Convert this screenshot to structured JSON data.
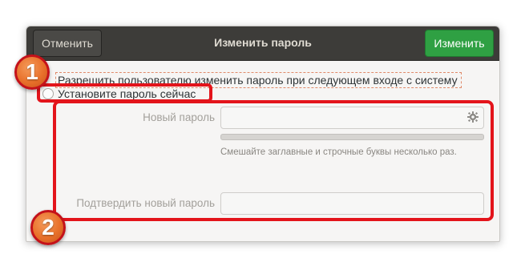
{
  "dialog": {
    "title": "Изменить пароль",
    "cancel_label": "Отменить",
    "change_label": "Изменить"
  },
  "options": {
    "allow_change_label": "Разрешить пользователю изменить пароль при следующем входе с систему",
    "set_now_label": "Установите пароль сейчас"
  },
  "form": {
    "new_password_label": "Новый пароль",
    "new_password_value": "",
    "hint": "Смешайте заглавные и строчные буквы несколько раз.",
    "confirm_label": "Подтвердить новый пароль",
    "confirm_value": "",
    "strength_level": 0
  },
  "annotations": {
    "badge_1": "1",
    "badge_2": "2"
  },
  "colors": {
    "header_bg": "#3d3c39",
    "accent_green": "#2fa043",
    "annotation_red": "#e3141b",
    "badge_orange": "#e8702a"
  },
  "icons": {
    "generate": "gear-icon",
    "radio": "radio-icon"
  }
}
